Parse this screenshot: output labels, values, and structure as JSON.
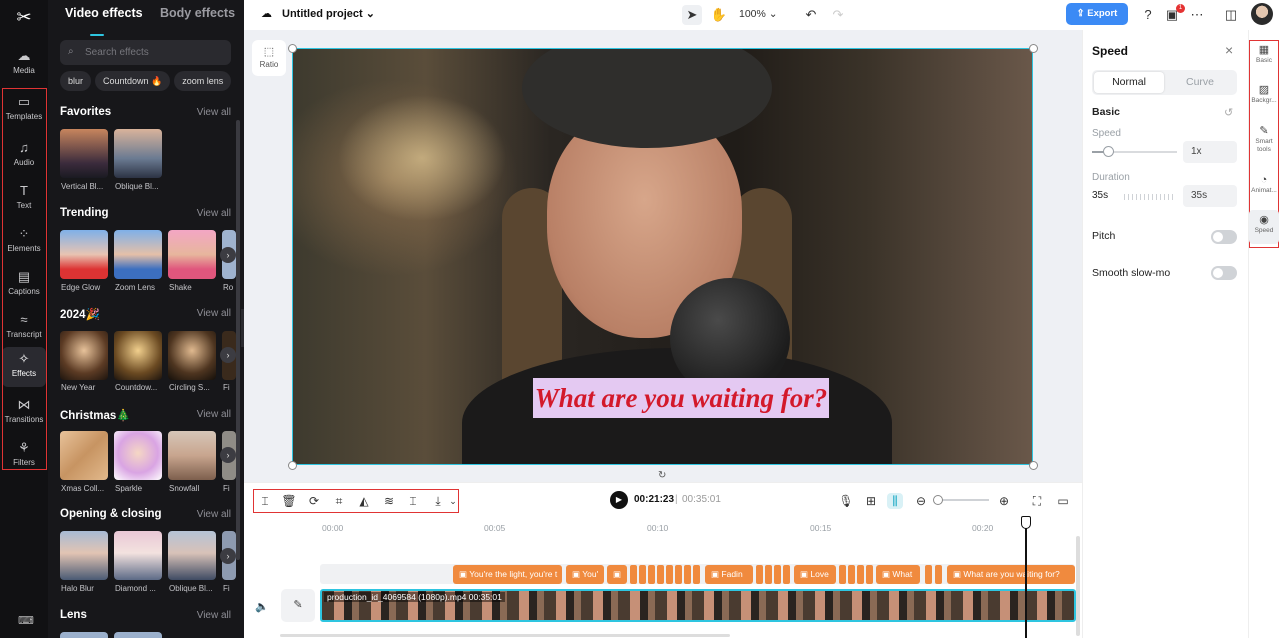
{
  "rail": {
    "logo": "✂",
    "items": [
      {
        "label": "Media",
        "icon": "cloud-icon"
      },
      {
        "label": "Templates",
        "icon": "templates-icon"
      },
      {
        "label": "Audio",
        "icon": "music-icon"
      },
      {
        "label": "Text",
        "icon": "text-icon"
      },
      {
        "label": "Elements",
        "icon": "elements-icon"
      },
      {
        "label": "Captions",
        "icon": "captions-icon"
      },
      {
        "label": "Transcript",
        "icon": "transcript-icon"
      },
      {
        "label": "Effects",
        "icon": "effects-icon"
      },
      {
        "label": "Transitions",
        "icon": "transitions-icon"
      },
      {
        "label": "Filters",
        "icon": "filters-icon"
      }
    ]
  },
  "panel": {
    "tab_video": "Video effects",
    "tab_body": "Body effects",
    "search_placeholder": "Search effects",
    "chips": [
      "blur",
      "Countdown 🔥",
      "zoom lens"
    ],
    "view_all": "View all",
    "sections": [
      {
        "title": "Favorites",
        "items": [
          "Vertical Bl...",
          "Oblique Bl..."
        ]
      },
      {
        "title": "Trending",
        "items": [
          "Edge Glow",
          "Zoom Lens",
          "Shake",
          "Ro"
        ]
      },
      {
        "title": "2024🎉",
        "items": [
          "New Year",
          "Countdow...",
          "Circling S...",
          "Fi"
        ]
      },
      {
        "title": "Christmas🎄",
        "items": [
          "Xmas Coll...",
          "Sparkle",
          "Snowfall",
          "Fi"
        ]
      },
      {
        "title": "Opening & closing",
        "items": [
          "Halo Blur",
          "Diamond ...",
          "Oblique Bl...",
          "Fi"
        ]
      },
      {
        "title": "Lens",
        "items": []
      }
    ]
  },
  "topbar": {
    "project_name": "Untitled project",
    "zoom": "100%",
    "export_label": "Export",
    "notification_count": "1"
  },
  "canvas": {
    "ratio_label": "Ratio",
    "caption_text": "What are you waiting for?"
  },
  "props": {
    "title": "Speed",
    "seg_normal": "Normal",
    "seg_curve": "Curve",
    "basic": "Basic",
    "speed_label": "Speed",
    "speed_value": "1x",
    "duration_label": "Duration",
    "duration_from": "35s",
    "duration_to": "35s",
    "pitch": "Pitch",
    "smooth": "Smooth slow-mo"
  },
  "tool_rail": [
    {
      "label": "Basic",
      "icon": "basic-icon"
    },
    {
      "label": "Backgr...",
      "icon": "background-icon"
    },
    {
      "label": "Smart tools",
      "icon": "smart-tools-icon"
    },
    {
      "label": "Animat...",
      "icon": "animation-icon"
    },
    {
      "label": "Speed",
      "icon": "speed-icon"
    }
  ],
  "playback": {
    "current": "00:21:23",
    "separator": "|",
    "total": "00:35:01"
  },
  "timeline": {
    "ruler": [
      "00:00",
      "00:05",
      "00:10",
      "00:15",
      "00:20"
    ],
    "captions": [
      "You're the light, you're t",
      "You'",
      "Fadin",
      "Love",
      "What",
      "What are you waiting for?"
    ],
    "video_label": "production_id_4069584 (1080p).mp4  00:35:01"
  },
  "colors": {
    "accent": "#2ec5e0",
    "export": "#3b8af5",
    "caption_clip": "#f08a3e",
    "highlight_box": "#e03434",
    "caption_text": "#d3192b",
    "caption_bg": "#e4c9f2"
  }
}
